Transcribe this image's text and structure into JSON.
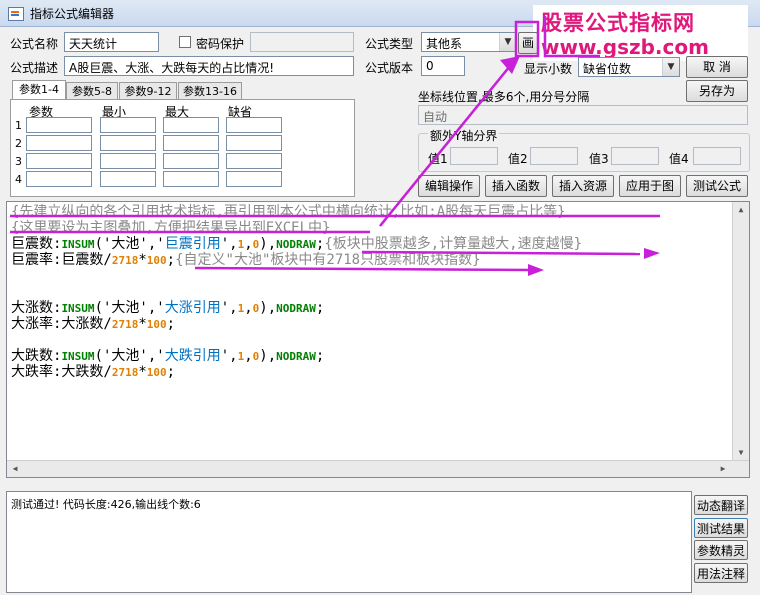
{
  "window": {
    "title": "指标公式编辑器"
  },
  "watermark": {
    "line1": "股票公式指标网",
    "line2": "www.gszb.com"
  },
  "form": {
    "name_label": "公式名称",
    "name_value": "天天统计",
    "password_label": "密码保护",
    "type_label": "公式类型",
    "type_value": "其他系",
    "desc_label": "公式描述",
    "desc_value": "A股巨震、大涨、大跌每天的占比情况!",
    "version_label": "公式版本",
    "version_value": "0",
    "draw_mode_partial": "画",
    "decimals_label": "显示小数",
    "decimals_value": "缺省位数",
    "cancel_button": "取  消",
    "save_as_button": "另存为"
  },
  "params": {
    "tabs": [
      "参数1-4",
      "参数5-8",
      "参数9-12",
      "参数13-16"
    ],
    "headers": [
      "参数",
      "最小",
      "最大",
      "缺省"
    ],
    "rows": [
      "1",
      "2",
      "3",
      "4"
    ]
  },
  "axis": {
    "label": "坐标线位置,最多6个,用分号分隔",
    "value": "自动",
    "extra_group": "额外Y轴分界",
    "value_labels": [
      "值1",
      "值2",
      "值3",
      "值4"
    ]
  },
  "toolbar": [
    "编辑操作",
    "插入函数",
    "插入资源",
    "应用于图",
    "测试公式"
  ],
  "code": {
    "comment1": "{先建立纵向的各个引用技术指标,再引用到本公式中横向统计,比如:A股每天巨震占比等}",
    "comment2": "{这里要设为主图叠加,方便把结果导出到EXCEL中}",
    "l3_var": "巨震数:",
    "l3_fn": "INSUM",
    "l3_a": "('大池','",
    "l3_b": "巨震引用",
    "l3_c": "',",
    "l3_n1": "1",
    "l3_d": ",",
    "l3_n2": "0",
    "l3_e": "),",
    "l3_kw": "NODRAW",
    "l3_f": ";",
    "l3_cmt": "{板块中股票越多,计算量越大,速度越慢}",
    "l4_var": "巨震率:巨震数/",
    "l4_num": "2718",
    "l4_op": "*",
    "l4_num2": "100",
    "l4_f": ";",
    "l4_cmt": "{自定义\"大池\"板块中有2718只股票和板块指数}",
    "l5_var": "大涨数:",
    "l5_b": "大涨引用",
    "l6_var": "大涨率:大涨数/",
    "l7_var": "大跌数:",
    "l7_b": "大跌引用",
    "l8_var": "大跌率:大跌数/"
  },
  "status": {
    "text": "测试通过! 代码长度:426,输出线个数:6"
  },
  "side_buttons": [
    "动态翻译",
    "测试结果",
    "参数精灵",
    "用法注释"
  ]
}
